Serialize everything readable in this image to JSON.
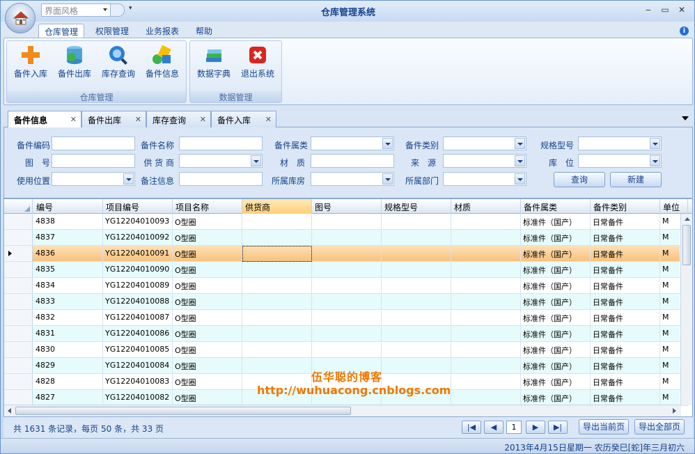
{
  "window": {
    "title": "仓库管理系统"
  },
  "qat": {
    "style_combo": "界面风格"
  },
  "menu": [
    "仓库管理",
    "权限管理",
    "业务报表",
    "帮助"
  ],
  "ribbon": {
    "groups": [
      {
        "label": "仓库管理",
        "buttons": [
          "备件入库",
          "备件出库",
          "库存查询",
          "备件信息"
        ]
      },
      {
        "label": "数据管理",
        "buttons": [
          "数据字典",
          "退出系统"
        ]
      }
    ]
  },
  "tabs": [
    "备件信息",
    "备件出库",
    "库存查询",
    "备件入库"
  ],
  "filters": {
    "labels": [
      "备件编码",
      "备件名称",
      "备件属类",
      "备件类别",
      "规格型号",
      "图　号",
      "供 货 商",
      "材　质",
      "来　源",
      "库　位",
      "使用位置",
      "备注信息",
      "所属库房",
      "所属部门"
    ],
    "query_button": "查询",
    "new_button": "新建"
  },
  "grid": {
    "columns": [
      "编号",
      "项目编号",
      "项目名称",
      "供货商",
      "图号",
      "规格型号",
      "材质",
      "备件属类",
      "备件类别",
      "单位"
    ],
    "rows": [
      [
        "4838",
        "YG12204010093",
        "O型圈",
        "",
        "",
        "",
        "",
        "标准件（国产）",
        "日常备件",
        "M"
      ],
      [
        "4837",
        "YG12204010092",
        "O型圈",
        "",
        "",
        "",
        "",
        "标准件（国产）",
        "日常备件",
        "M"
      ],
      [
        "4836",
        "YG12204010091",
        "O型圈",
        "",
        "",
        "",
        "",
        "标准件（国产）",
        "日常备件",
        "M"
      ],
      [
        "4835",
        "YG12204010090",
        "O型圈",
        "",
        "",
        "",
        "",
        "标准件（国产）",
        "日常备件",
        "M"
      ],
      [
        "4834",
        "YG12204010089",
        "O型圈",
        "",
        "",
        "",
        "",
        "标准件（国产）",
        "日常备件",
        "M"
      ],
      [
        "4833",
        "YG12204010088",
        "O型圈",
        "",
        "",
        "",
        "",
        "标准件（国产）",
        "日常备件",
        "M"
      ],
      [
        "4832",
        "YG12204010087",
        "O型圈",
        "",
        "",
        "",
        "",
        "标准件（国产）",
        "日常备件",
        "M"
      ],
      [
        "4831",
        "YG12204010086",
        "O型圈",
        "",
        "",
        "",
        "",
        "标准件（国产）",
        "日常备件",
        "M"
      ],
      [
        "4830",
        "YG12204010085",
        "O型圈",
        "",
        "",
        "",
        "",
        "标准件（国产）",
        "日常备件",
        "M"
      ],
      [
        "4829",
        "YG12204010084",
        "O型圈",
        "",
        "",
        "",
        "",
        "标准件（国产）",
        "日常备件",
        "M"
      ],
      [
        "4828",
        "YG12204010083",
        "O型圈",
        "",
        "",
        "",
        "",
        "标准件（国产）",
        "日常备件",
        "M"
      ],
      [
        "4827",
        "YG12204010082",
        "O型圈",
        "",
        "",
        "",
        "",
        "标准件（国产）",
        "日常备件",
        "M"
      ]
    ]
  },
  "pager": {
    "info": "共 1631 条记录，每页 50 条，共 33 页",
    "first": "|◀",
    "prev": "◀",
    "current": "1",
    "next": "▶",
    "last": "▶|",
    "export_current": "导出当前页",
    "export_all": "导出全部页"
  },
  "watermark": {
    "line1": "伍华聪的博客",
    "line2": "http://wuhuacong.cnblogs.com"
  },
  "status": {
    "date": "2013年4月15日星期一 农历癸巳[蛇]年三月初六"
  },
  "colors": {
    "selected_row": "#f9c079",
    "alt_row": "#e6fbfb",
    "accent": "#15428b"
  }
}
